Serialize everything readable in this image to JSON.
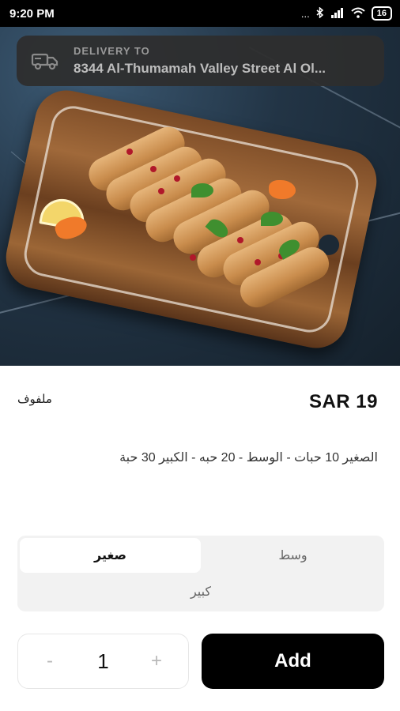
{
  "status_bar": {
    "time": "9:20 PM",
    "signal_text": "...",
    "battery": "16"
  },
  "delivery": {
    "label": "DELIVERY TO",
    "address": "8344 Al-Thumamah Valley Street Al Ol..."
  },
  "hero_image": {
    "icon": "stuffed-cabbage-rolls-photo"
  },
  "product": {
    "name": "ملفوف",
    "price": "SAR 19",
    "description": "الصغير 10 حبات - الوسط - 20 حبه - الكبير 30 حبة"
  },
  "sizes": {
    "options": [
      {
        "label": "وسط",
        "selected": false
      },
      {
        "label": "صغير",
        "selected": true
      },
      {
        "label": "كبير",
        "selected": false
      }
    ]
  },
  "cart": {
    "decrement": "-",
    "quantity": "1",
    "increment": "+",
    "add_label": "Add"
  },
  "colors": {
    "primary": "#000000",
    "banner": "#2e2e2e",
    "selector_bg": "#f2f2f2"
  }
}
